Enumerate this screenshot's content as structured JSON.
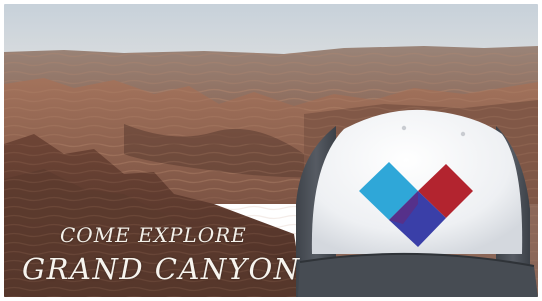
{
  "image": {
    "caption_line1": "COME EXPLORE",
    "caption_line2": "GRAND CANYON",
    "colors": {
      "sky": "#c9d3dc",
      "canyon_rock": "#8a5a45",
      "cap_front": "#f2f3f5",
      "cap_mesh": "#4a4f56",
      "heart_cyan": "#2fa7d8",
      "heart_red": "#b3242f",
      "heart_blue": "#3a3fa8",
      "heart_purple": "#5a2f86"
    },
    "objects": [
      "grand-canyon-landscape",
      "trucker-cap",
      "heart-logo",
      "caption-text"
    ]
  }
}
